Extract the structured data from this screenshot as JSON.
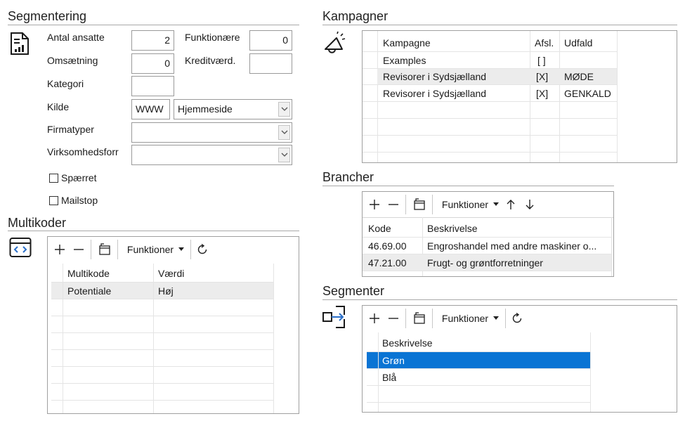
{
  "segmentering": {
    "title": "Segmentering",
    "antal_ansatte": {
      "label": "Antal ansatte",
      "value": "2"
    },
    "funktionaere": {
      "label": "Funktionære",
      "value": "0"
    },
    "omsaetning": {
      "label": "Omsætning",
      "value": "0"
    },
    "kreditvaerd": {
      "label": "Kreditværd.",
      "value": ""
    },
    "kategori": {
      "label": "Kategori",
      "value": ""
    },
    "kilde": {
      "label": "Kilde",
      "code": "WWW",
      "selected": "Hjemmeside"
    },
    "firmatyper": {
      "label": "Firmatyper",
      "selected": ""
    },
    "virksomhedsform": {
      "label": "Virksomhedsforr",
      "selected": ""
    },
    "spaerret": {
      "label": "Spærret",
      "checked": false
    },
    "mailstop": {
      "label": "Mailstop",
      "checked": false
    }
  },
  "multikoder": {
    "title": "Multikoder",
    "toolbar": {
      "functions": "Funktioner"
    },
    "columns": [
      "Multikode",
      "Værdi"
    ],
    "rows": [
      {
        "multikode": "Potentiale",
        "vaerdi": "Høj"
      }
    ]
  },
  "kampagner": {
    "title": "Kampagner",
    "columns": [
      "Kampagne",
      "Afsl.",
      "Udfald"
    ],
    "rows": [
      {
        "kampagne": "Examples",
        "afsl": "[ ]",
        "udfald": ""
      },
      {
        "kampagne": "Revisorer i Sydsjælland",
        "afsl": "[X]",
        "udfald": "MØDE"
      },
      {
        "kampagne": "Revisorer i Sydsjælland",
        "afsl": "[X]",
        "udfald": "GENKALD"
      }
    ]
  },
  "brancher": {
    "title": "Brancher",
    "toolbar": {
      "functions": "Funktioner"
    },
    "columns": [
      "Kode",
      "Beskrivelse"
    ],
    "rows": [
      {
        "kode": "46.69.00",
        "beskrivelse": "Engroshandel med andre maskiner o..."
      },
      {
        "kode": "47.21.00",
        "beskrivelse": "Frugt- og grøntforretninger"
      }
    ]
  },
  "segmenter": {
    "title": "Segmenter",
    "toolbar": {
      "functions": "Funktioner"
    },
    "columns": [
      "Beskrivelse"
    ],
    "rows": [
      {
        "beskrivelse": "Grøn",
        "selected": true
      },
      {
        "beskrivelse": "Blå",
        "selected": false
      }
    ]
  },
  "colors": {
    "selection": "#0a74d4",
    "alt_row": "#ececec",
    "rule": "#a8a8a8"
  },
  "icons": {
    "segmentering": "report-document-icon",
    "kampagner": "megaphone-icon",
    "multikoder": "code-window-icon",
    "segmenter": "transfer-segment-icon"
  }
}
